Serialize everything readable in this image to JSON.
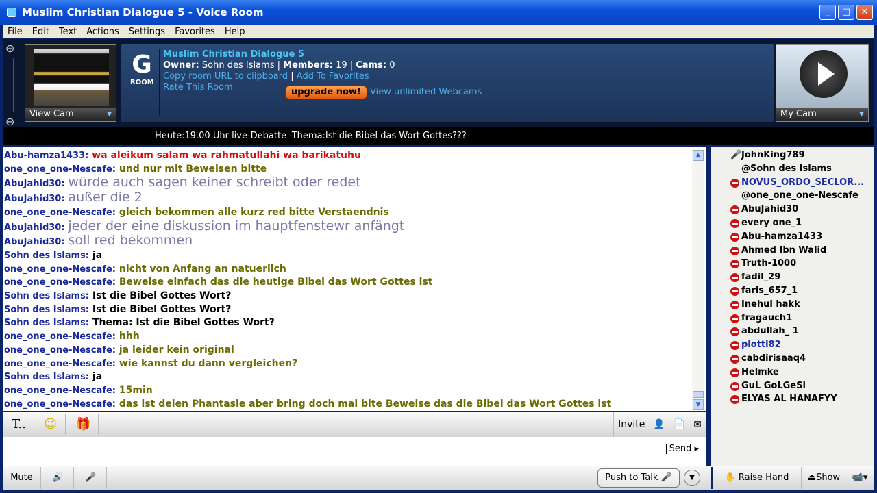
{
  "window": {
    "title": "Muslim Christian Dialogue 5 - Voice Room",
    "min": "_",
    "max": "□",
    "close": "✕"
  },
  "menu": [
    "File",
    "Edit",
    "Text",
    "Actions",
    "Settings",
    "Favorites",
    "Help"
  ],
  "header": {
    "view_cam": "View Cam",
    "room_badge": "G",
    "room_badge_sub": "ROOM",
    "room_name": "Muslim Christian Dialogue 5",
    "owner_label": "Owner:",
    "owner": "Sohn des Islams",
    "members_label": "Members:",
    "members": "19",
    "cams_label": "Cams:",
    "cams": "0",
    "copy_url": "Copy room URL to clipboard",
    "add_fav": "Add To Favorites",
    "rate": "Rate This Room",
    "upgrade": "upgrade now!",
    "unlimited": "View unlimited Webcams",
    "my_cam": "My Cam"
  },
  "banner": "Heute:19.00 Uhr live-Debatte -Thema:Ist die Bibel das Wort Gottes???",
  "messages": [
    {
      "name": "Abu-hamza1433:",
      "text": "wa aleikum salam wa rahmatullahi wa barikatuhu",
      "style": "red"
    },
    {
      "name": "one_one_one-Nescafe:",
      "text": "und nur mit Beweisen bitte",
      "style": "olive"
    },
    {
      "name": "AbuJahid30:",
      "text": "würde auch sagen keiner schreibt oder redet",
      "style": "gray"
    },
    {
      "name": "AbuJahid30:",
      "text": "außer die 2",
      "style": "gray"
    },
    {
      "name": "one_one_one-Nescafe:",
      "text": "gleich bekommen alle kurz red bitte Verstaendnis",
      "style": "olive"
    },
    {
      "name": "AbuJahid30:",
      "text": "jeder der eine diskussion im hauptfenstewr anfängt",
      "style": "gray"
    },
    {
      "name": "AbuJahid30:",
      "text": "soll red bekommen",
      "style": "gray"
    },
    {
      "name": "Sohn des Islams:",
      "text": "ja",
      "style": "black"
    },
    {
      "name": "one_one_one-Nescafe:",
      "text": "nicht von Anfang an natuerlich",
      "style": "olive"
    },
    {
      "name": "one_one_one-Nescafe:",
      "text": "Beweise einfach das die heutige Bibel das Wort Gottes ist",
      "style": "olive"
    },
    {
      "name": "Sohn des Islams:",
      "text": "Ist die Bibel Gottes Wort?",
      "style": "black"
    },
    {
      "name": "Sohn des Islams:",
      "text": "Ist die Bibel Gottes Wort?",
      "style": "black"
    },
    {
      "name": "Sohn des Islams:",
      "text": "Thema: Ist die Bibel Gottes Wort?",
      "style": "black"
    },
    {
      "name": "one_one_one-Nescafe:",
      "text": "hhh",
      "style": "olive"
    },
    {
      "name": "one_one_one-Nescafe:",
      "text": "ja leider kein original",
      "style": "olive"
    },
    {
      "name": "one_one_one-Nescafe:",
      "text": "wie kannst du dann vergleichen?",
      "style": "olive"
    },
    {
      "name": "Sohn des Islams:",
      "text": "ja",
      "style": "black"
    },
    {
      "name": "one_one_one-Nescafe:",
      "text": "15min",
      "style": "olive"
    },
    {
      "name": "one_one_one-Nescafe:",
      "text": "das ist deien Phantasie  aber bring doch mal bite Beweise das die Bibel das Wort Gottes ist",
      "style": "olive"
    }
  ],
  "users": [
    {
      "name": "JohnKing789",
      "icon": "microphone-icon"
    },
    {
      "name": "@Sohn des Islams",
      "icon": ""
    },
    {
      "name": "NOVUS_ORDO_SECLOR...",
      "icon": "blocked-icon",
      "blue": true
    },
    {
      "name": "@one_one_one-Nescafe",
      "icon": ""
    },
    {
      "name": "AbuJahid30",
      "icon": "blocked-icon"
    },
    {
      "name": "every one_1",
      "icon": "blocked-icon"
    },
    {
      "name": "Abu-hamza1433",
      "icon": "blocked-icon"
    },
    {
      "name": "Ahmed Ibn Walid",
      "icon": "blocked-icon"
    },
    {
      "name": "Truth-1000",
      "icon": "blocked-icon"
    },
    {
      "name": "fadil_29",
      "icon": "blocked-icon"
    },
    {
      "name": "faris_657_1",
      "icon": "blocked-icon"
    },
    {
      "name": "Inehul hakk",
      "icon": "blocked-icon"
    },
    {
      "name": "fragauch1",
      "icon": "blocked-icon"
    },
    {
      "name": "abdullah_ 1",
      "icon": "blocked-icon"
    },
    {
      "name": "plotti82",
      "icon": "blocked-icon",
      "blue": true
    },
    {
      "name": "cabdirisaaq4",
      "icon": "blocked-icon"
    },
    {
      "name": "Helmke",
      "icon": "blocked-icon"
    },
    {
      "name": "GuL GoLGeSi",
      "icon": "blocked-icon"
    },
    {
      "name": "ELYAS AL HANAFYY",
      "icon": "blocked-icon"
    }
  ],
  "toolbar": {
    "text_format": "T..",
    "emoji": "☺",
    "gift": "🎁",
    "invite": "Invite"
  },
  "input": {
    "send": "Send ▸"
  },
  "bottom": {
    "mute": "Mute",
    "speaker": "🔊",
    "mic": "🎤",
    "push_to_talk": "Push to Talk 🎤",
    "ptt_menu": "▼",
    "raise_hand": "✋ Raise Hand",
    "show": "⏏Show",
    "cam_menu": "📹▾"
  }
}
